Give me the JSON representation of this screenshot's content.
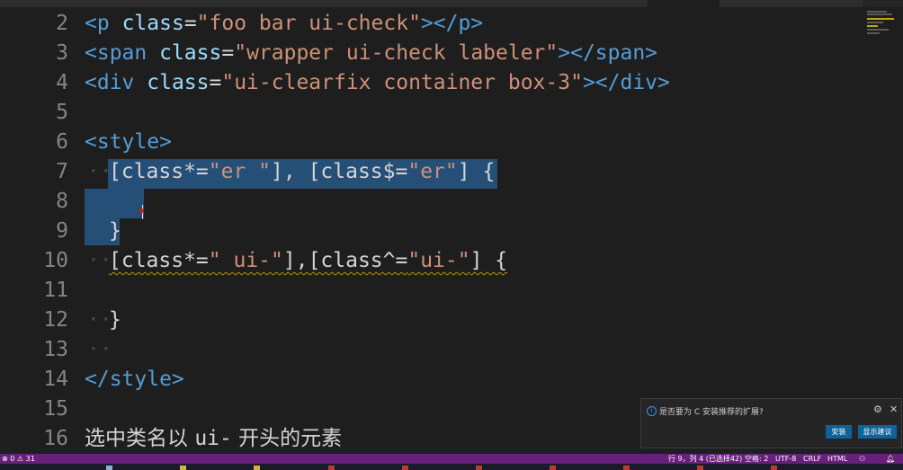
{
  "tabs": [
    "",
    "",
    "",
    "",
    "",
    "",
    "",
    "",
    "",
    "",
    "",
    ""
  ],
  "editor": {
    "lines": [
      {
        "num": "2",
        "html_parts": [
          {
            "t": "tag",
            "v": "<p"
          },
          {
            "t": "white",
            "v": " "
          },
          {
            "t": "attr",
            "v": "class"
          },
          {
            "t": "white",
            "v": "="
          },
          {
            "t": "str",
            "v": "\"foo bar ui-check\""
          },
          {
            "t": "tag",
            "v": "></p>"
          }
        ]
      },
      {
        "num": "3",
        "html_parts": [
          {
            "t": "tag",
            "v": "<span"
          },
          {
            "t": "white",
            "v": " "
          },
          {
            "t": "attr",
            "v": "class"
          },
          {
            "t": "white",
            "v": "="
          },
          {
            "t": "str",
            "v": "\"wrapper ui-check labeler\""
          },
          {
            "t": "tag",
            "v": "></span>"
          }
        ]
      },
      {
        "num": "4",
        "html_parts": [
          {
            "t": "tag",
            "v": "<div"
          },
          {
            "t": "white",
            "v": " "
          },
          {
            "t": "attr",
            "v": "class"
          },
          {
            "t": "white",
            "v": "="
          },
          {
            "t": "str",
            "v": "\"ui-clearfix container box-3\""
          },
          {
            "t": "tag",
            "v": "></div>"
          }
        ]
      },
      {
        "num": "5",
        "html_parts": []
      },
      {
        "num": "6",
        "html_parts": [
          {
            "t": "tag",
            "v": "<style>"
          }
        ]
      },
      {
        "num": "7",
        "html_parts": [
          {
            "t": "white",
            "v": "[class*="
          },
          {
            "t": "str",
            "v": "\"er \""
          },
          {
            "t": "white",
            "v": "], [class$="
          },
          {
            "t": "str",
            "v": "\"er\""
          },
          {
            "t": "white",
            "v": "] {"
          }
        ]
      },
      {
        "num": "8",
        "html_parts": []
      },
      {
        "num": "9",
        "html_parts": [
          {
            "t": "white",
            "v": "}"
          }
        ]
      },
      {
        "num": "10",
        "html_parts": [
          {
            "t": "white",
            "v": "[class*="
          },
          {
            "t": "str",
            "v": "\" ui-\""
          },
          {
            "t": "white",
            "v": "],[class^="
          },
          {
            "t": "str",
            "v": "\"ui-\""
          },
          {
            "t": "white",
            "v": "] {"
          }
        ]
      },
      {
        "num": "11",
        "html_parts": []
      },
      {
        "num": "12",
        "html_parts": [
          {
            "t": "white",
            "v": "}"
          }
        ]
      },
      {
        "num": "13",
        "html_parts": []
      },
      {
        "num": "14",
        "html_parts": [
          {
            "t": "tag",
            "v": "</style>"
          }
        ]
      },
      {
        "num": "15",
        "html_parts": []
      },
      {
        "num": "16",
        "html_parts": [
          {
            "t": "text",
            "v": "选中类名以 "
          },
          {
            "t": "white",
            "v": "ui-"
          },
          {
            "t": "text",
            "v": " 开头的元素"
          }
        ]
      }
    ]
  },
  "notification": {
    "message": "是否要为 C 安装推荐的扩展?",
    "install_label": "安装",
    "show_label": "显示建议"
  },
  "statusbar": {
    "errors": "0",
    "warnings": "31",
    "position": "行 9，列 4 (已选择42)",
    "spaces": "空格: 2",
    "encoding": "UTF-8",
    "eol": "CRLF",
    "language": "HTML"
  },
  "colors": {
    "statusbar": "#68217a",
    "selection": "#264f78",
    "tag": "#569cd6",
    "attr": "#9cdcfe",
    "string": "#ce9178"
  }
}
